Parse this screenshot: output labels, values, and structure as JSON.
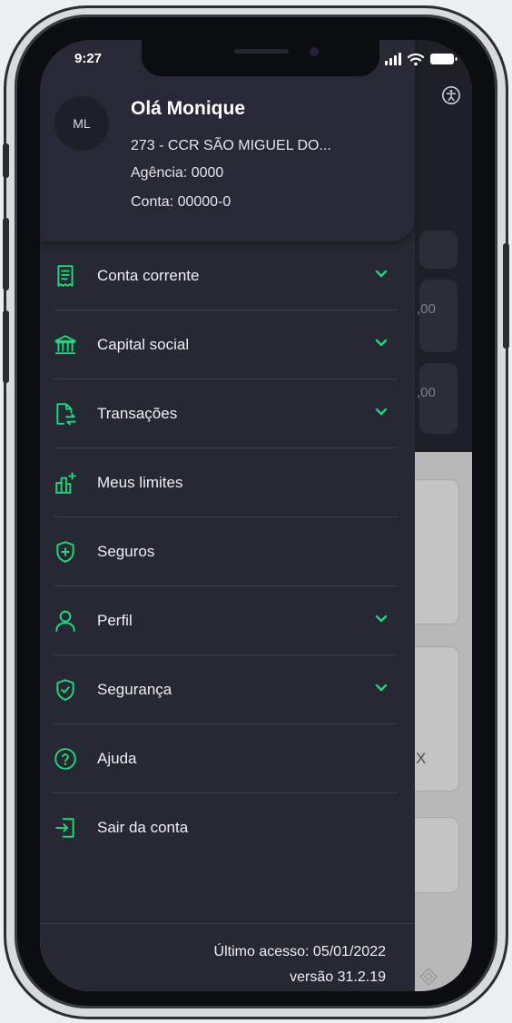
{
  "status_bar": {
    "time": "9:27"
  },
  "drawer": {
    "avatar_initials": "ML",
    "greeting": "Olá Monique",
    "cooperative": "273 - CCR SÃO MIGUEL DO...",
    "agency": "Agência: 0000",
    "account": "Conta: 00000-0",
    "menu": [
      {
        "label": "Conta corrente",
        "icon": "receipt-icon",
        "expandable": true
      },
      {
        "label": "Capital social",
        "icon": "bank-icon",
        "expandable": true
      },
      {
        "label": "Transações",
        "icon": "transfer-icon",
        "expandable": true
      },
      {
        "label": "Meus limites",
        "icon": "chart-limits-icon",
        "expandable": false
      },
      {
        "label": "Seguros",
        "icon": "shield-plus-icon",
        "expandable": false
      },
      {
        "label": "Perfil",
        "icon": "person-icon",
        "expandable": true
      },
      {
        "label": "Segurança",
        "icon": "shield-check-icon",
        "expandable": true
      },
      {
        "label": "Ajuda",
        "icon": "help-icon",
        "expandable": false
      },
      {
        "label": "Sair da conta",
        "icon": "logout-icon",
        "expandable": false
      }
    ],
    "last_access": "Último acesso: 05/01/2022",
    "version": "versão 31.2.19"
  },
  "background": {
    "value_1": ",00",
    "value_2": ",00",
    "label_x": "X"
  },
  "colors": {
    "accent": "#1fd67a",
    "drawer_bg": "#262833",
    "header_bg": "#272a36"
  }
}
